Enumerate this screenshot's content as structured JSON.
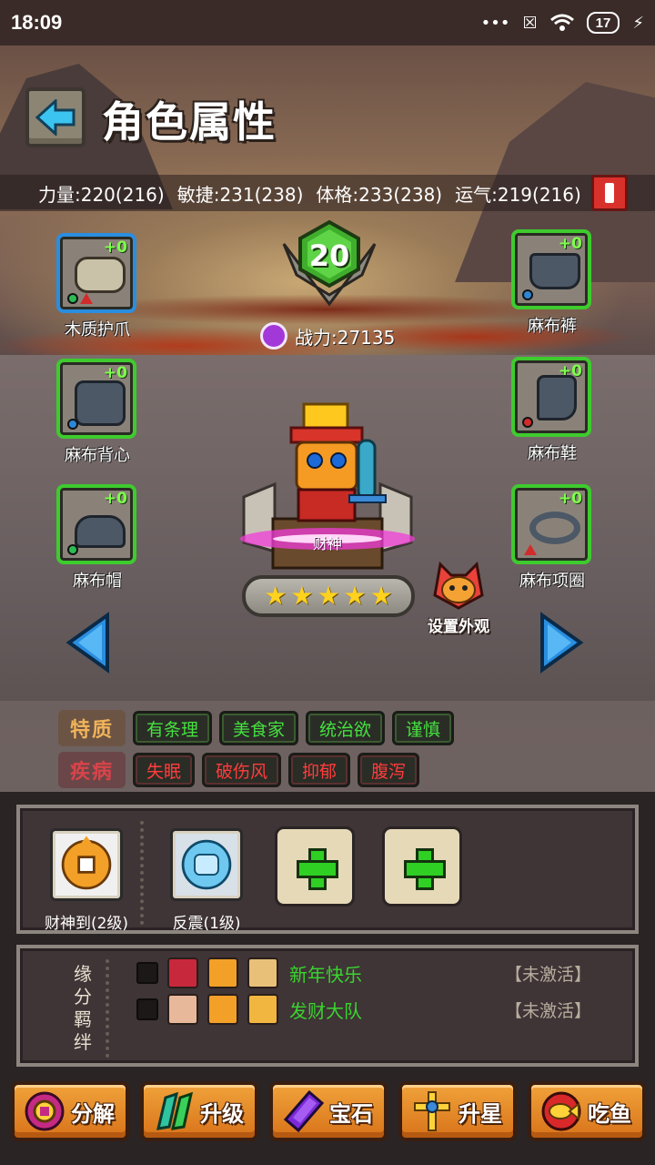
{
  "status_bar": {
    "time": "18:09",
    "battery": "17",
    "icons": [
      "signal-dots-icon",
      "close-box-icon",
      "wifi-icon",
      "battery-icon",
      "charging-bolt-icon"
    ]
  },
  "header": {
    "title": "角色属性",
    "back_icon": "back-arrow-icon"
  },
  "stats": [
    {
      "label": "力量:220(216)"
    },
    {
      "label": "敏捷:231(238)"
    },
    {
      "label": "体格:233(238)"
    },
    {
      "label": "运气:219(216)"
    }
  ],
  "alert_icon": "exclamation-icon",
  "character": {
    "level": "20",
    "power": "战力:27135",
    "name": "财神",
    "stars": 5,
    "appearance_label": "设置外观"
  },
  "equipment": {
    "left": [
      {
        "name": "木质护爪",
        "plus": "+0"
      },
      {
        "name": "麻布背心",
        "plus": "+0"
      },
      {
        "name": "麻布帽",
        "plus": "+0"
      }
    ],
    "right": [
      {
        "name": "麻布裤",
        "plus": "+0"
      },
      {
        "name": "麻布鞋",
        "plus": "+0"
      },
      {
        "name": "麻布项圈",
        "plus": "+0"
      }
    ]
  },
  "traits": {
    "trait_label": "特质",
    "trait_items": [
      "有条理",
      "美食家",
      "统治欲",
      "谨慎"
    ],
    "disease_label": "疾病",
    "disease_items": [
      "失眠",
      "破伤风",
      "抑郁",
      "腹泻"
    ]
  },
  "skills": [
    {
      "name": "财神到(2级)"
    },
    {
      "name": "反震(1级)"
    }
  ],
  "bonds": {
    "title": [
      "缘",
      "分",
      "羁",
      "绊"
    ],
    "rows": [
      {
        "name": "新年快乐",
        "status": "【未激活】"
      },
      {
        "name": "发财大队",
        "status": "【未激活】"
      }
    ]
  },
  "actions": [
    {
      "label": "分解",
      "icon": "decompose-icon"
    },
    {
      "label": "升级",
      "icon": "upgrade-icon"
    },
    {
      "label": "宝石",
      "icon": "gem-icon"
    },
    {
      "label": "升星",
      "icon": "star-up-icon"
    },
    {
      "label": "吃鱼",
      "icon": "fish-icon"
    }
  ],
  "colors": {
    "green_accent": "#3ecb2e",
    "blue_slot": "#2a8ee0",
    "trait_good": "#46e040",
    "trait_bad": "#ff3c3c",
    "button_orange": "#e08a28"
  }
}
